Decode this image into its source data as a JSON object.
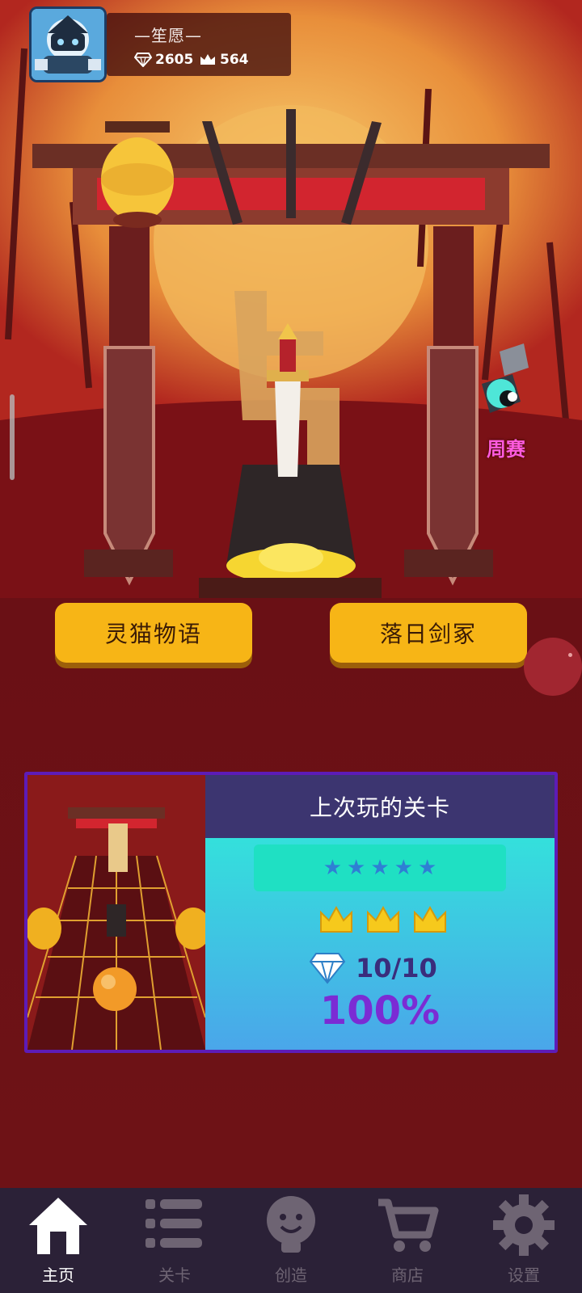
{
  "profile": {
    "name": "—笙愿—",
    "diamonds": "2605",
    "crowns": "564"
  },
  "events": {
    "weekly_label": "周赛"
  },
  "stories": [
    {
      "label": "灵猫物语"
    },
    {
      "label": "落日剑冢"
    }
  ],
  "last_level": {
    "title": "上次玩的关卡",
    "stars": 5,
    "crowns": 3,
    "gems": "10/10",
    "percent": "100%"
  },
  "nav": {
    "items": [
      {
        "label": "主页",
        "icon": "home-icon",
        "active": true
      },
      {
        "label": "关卡",
        "icon": "list-icon",
        "active": false
      },
      {
        "label": "创造",
        "icon": "idea-bulb-icon",
        "active": false
      },
      {
        "label": "商店",
        "icon": "cart-icon",
        "active": false
      },
      {
        "label": "设置",
        "icon": "gear-icon",
        "active": false
      }
    ]
  },
  "colors": {
    "button_yellow": "#f7b516",
    "card_border": "#5d1cb7",
    "percent_purple": "#7b2cd4",
    "weekly_pink": "#ff5bdf",
    "nav_bg": "#2b2137"
  }
}
